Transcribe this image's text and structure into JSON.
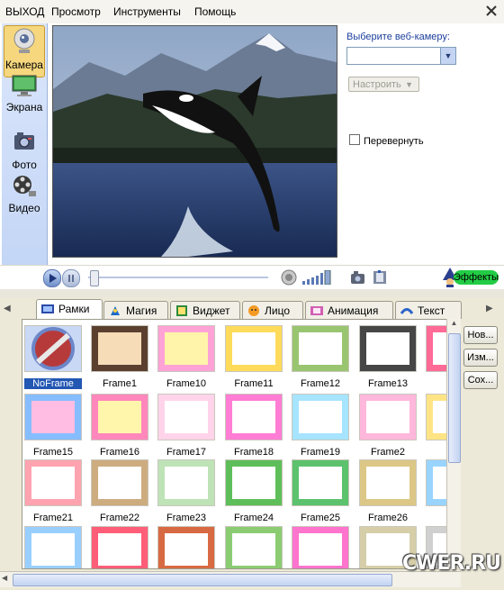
{
  "menu": [
    "ВЫХОД",
    "Просмотр",
    "Инструменты",
    "Помощь"
  ],
  "nav": [
    {
      "label": "Камера",
      "icon": "webcam-icon",
      "active": true
    },
    {
      "label": "Экрана",
      "icon": "monitor-icon"
    },
    {
      "label": "Фото",
      "icon": "photo-icon"
    },
    {
      "label": "Видео",
      "icon": "film-reel-icon"
    }
  ],
  "camera": {
    "select_label": "Выберите веб-камеру:",
    "selected": "",
    "setup_button": "Настроить",
    "flip_label": "Перевернуть",
    "flip_checked": false
  },
  "controls": {
    "effects_label": "Эффекты"
  },
  "tabs": [
    {
      "label": "Рамки",
      "icon": "frames-tab-icon",
      "active": true
    },
    {
      "label": "Магия",
      "icon": "magic-tab-icon"
    },
    {
      "label": "Виджет",
      "icon": "widget-tab-icon"
    },
    {
      "label": "Лицо",
      "icon": "face-tab-icon"
    },
    {
      "label": "Анимация",
      "icon": "animation-tab-icon"
    },
    {
      "label": "Текст",
      "icon": "text-tab-icon"
    }
  ],
  "frames": [
    "NoFrame",
    "Frame1",
    "Frame10",
    "Frame11",
    "Frame12",
    "Frame13",
    "Fr",
    "Frame15",
    "Frame16",
    "Frame17",
    "Frame18",
    "Frame19",
    "Frame2",
    "Fr",
    "Frame21",
    "Frame22",
    "Frame23",
    "Frame24",
    "Frame25",
    "Frame26",
    "Fr",
    "",
    "",
    "",
    "",
    "",
    "",
    ""
  ],
  "selected_frame": "NoFrame",
  "side_buttons": [
    "Нов...",
    "Изм...",
    "Сох..."
  ],
  "watermark": "CWER.RU"
}
